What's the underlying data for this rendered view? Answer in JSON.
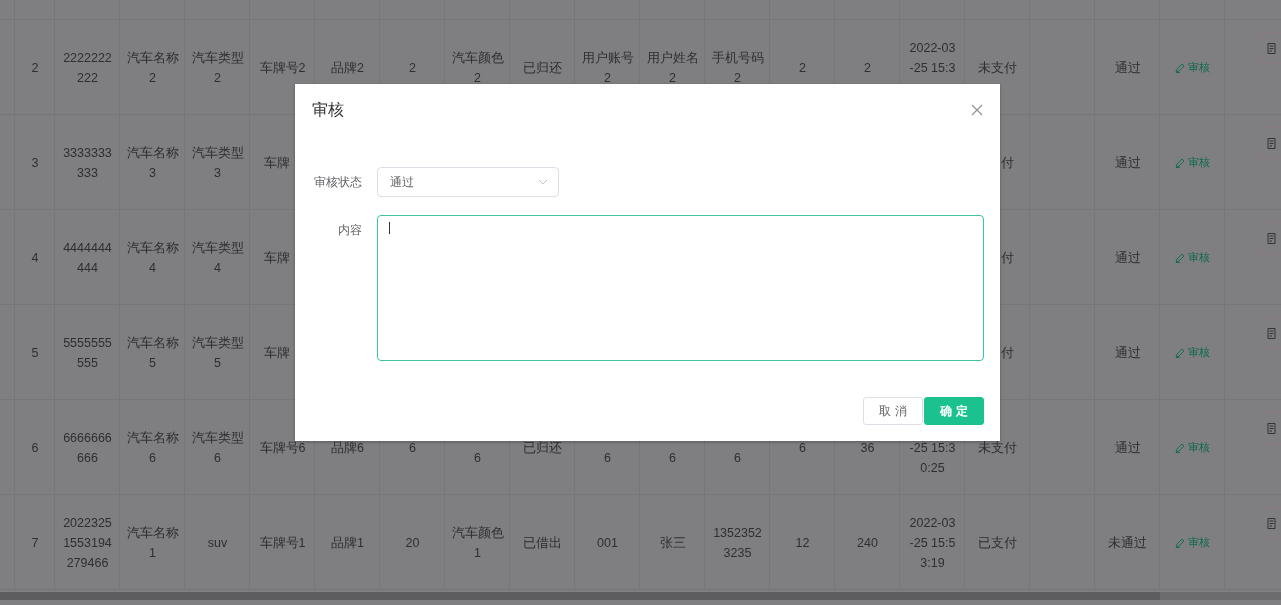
{
  "table": {
    "rows": [
      {
        "cells": [
          "2",
          "2222222\n222",
          "汽车名称\n2",
          "汽车类型\n2",
          "车牌号2",
          "品牌2",
          "2",
          "汽车颜色\n2",
          "已归还",
          "用户账号\n2",
          "用户姓名\n2",
          "手机号码\n2",
          "2",
          "2",
          {
            "text": "2022-03\n-25 15:3",
            "kind": "upper"
          },
          "未支付",
          null,
          "通过"
        ],
        "action": "审核"
      },
      {
        "cells": [
          "3",
          "3333333\n333",
          "汽车名称\n3",
          "汽车类型\n3",
          {
            "text": "车牌",
            "kind": "head"
          },
          null,
          null,
          null,
          null,
          null,
          null,
          null,
          null,
          null,
          null,
          {
            "text": "付",
            "kind": "tail"
          },
          null,
          "通过"
        ],
        "action": "审核"
      },
      {
        "cells": [
          "4",
          "4444444\n444",
          "汽车名称\n4",
          "汽车类型\n4",
          {
            "text": "车牌",
            "kind": "head"
          },
          null,
          null,
          null,
          null,
          null,
          null,
          null,
          null,
          null,
          null,
          {
            "text": "付",
            "kind": "tail"
          },
          null,
          "通过"
        ],
        "action": "审核"
      },
      {
        "cells": [
          "5",
          "5555555\n555",
          "汽车名称\n5",
          "汽车类型\n5",
          {
            "text": "车牌",
            "kind": "head"
          },
          null,
          null,
          null,
          null,
          null,
          null,
          null,
          null,
          null,
          null,
          {
            "text": "付",
            "kind": "tail"
          },
          null,
          "通过"
        ],
        "action": "审核"
      },
      {
        "cells": [
          "6",
          "6666666\n666",
          "汽车名称\n6",
          "汽车类型\n6",
          "车牌号6",
          "品牌6",
          "6",
          {
            "text": "6",
            "kind": "lower"
          },
          "已归还",
          {
            "text": "6",
            "kind": "lower"
          },
          {
            "text": "6",
            "kind": "lower"
          },
          {
            "text": "6",
            "kind": "lower"
          },
          "6",
          "36",
          {
            "text": "-25 15:3\n0:25",
            "kind": "lower"
          },
          "未支付",
          null,
          "通过"
        ],
        "action": "审核"
      },
      {
        "cells": [
          "7",
          "2022325\n1553194\n279466",
          "汽车名称\n1",
          "suv",
          "车牌号1",
          "品牌1",
          "20",
          "汽车颜色\n1",
          "已借出",
          "001",
          "张三",
          "1352352\n3235",
          "12",
          "240",
          "2022-03\n-25 15:5\n3:19",
          "已支付",
          null,
          "未通过"
        ],
        "action": "审核"
      }
    ]
  },
  "dialog": {
    "title": "审核",
    "fields": [
      {
        "kind": "select",
        "label": "审核状态",
        "value": "通过"
      },
      {
        "kind": "textarea",
        "label": "内容",
        "focused": true
      }
    ],
    "buttons": [
      {
        "label": "取消",
        "kind": "default"
      },
      {
        "label": "确定",
        "kind": "primary"
      }
    ]
  }
}
